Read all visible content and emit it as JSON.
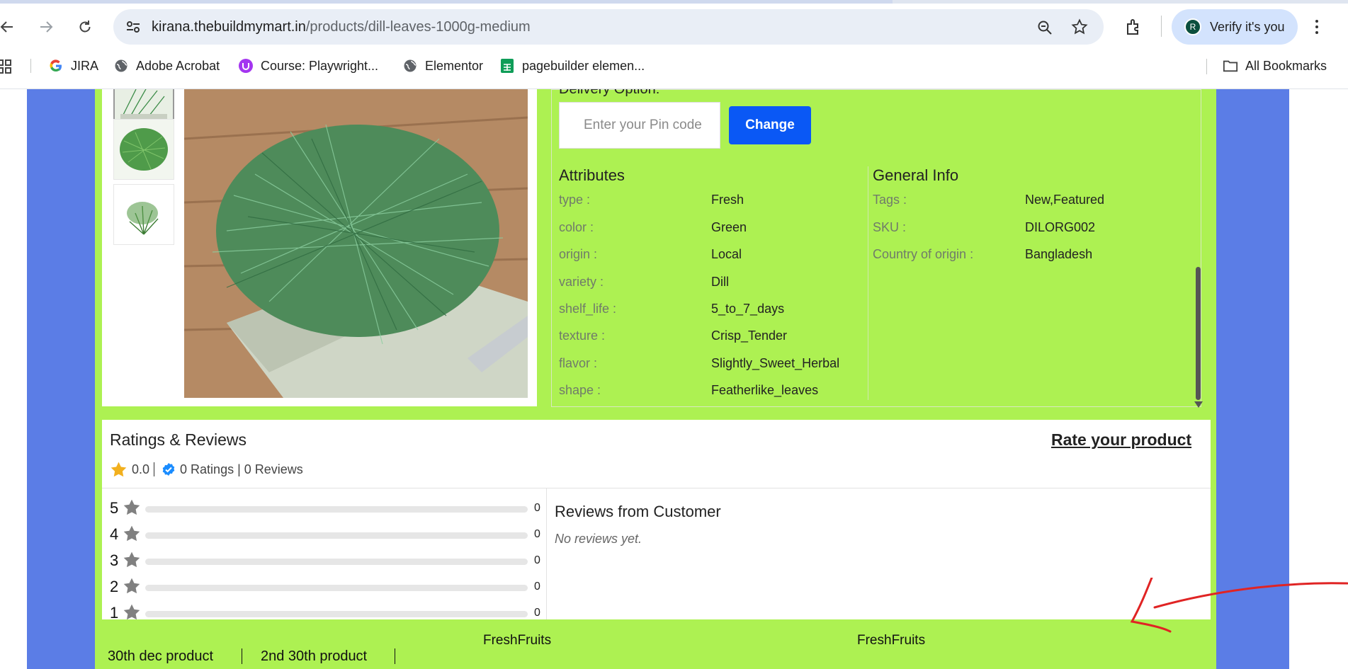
{
  "browser": {
    "url_host": "kirana.thebuildmymart.in",
    "url_path": "/products/dill-leaves-1000g-medium",
    "profile_initial": "R",
    "verify_label": "Verify it's you",
    "bookmarks": [
      {
        "label": "JIRA",
        "icon": "google-icon"
      },
      {
        "label": "Adobe Acrobat",
        "icon": "globe-icon"
      },
      {
        "label": "Course: Playwright...",
        "icon": "udemy-icon"
      },
      {
        "label": "Elementor",
        "icon": "globe-icon"
      },
      {
        "label": "pagebuilder elemen...",
        "icon": "sheets-icon"
      }
    ],
    "all_bookmarks_label": "All Bookmarks"
  },
  "delivery": {
    "label": "Delivery Option:",
    "pin_placeholder": "Enter your Pin code",
    "change_label": "Change"
  },
  "attributes": {
    "heading": "Attributes",
    "items": [
      {
        "label": "type :",
        "value": "Fresh"
      },
      {
        "label": "color :",
        "value": "Green"
      },
      {
        "label": "origin :",
        "value": "Local"
      },
      {
        "label": "variety :",
        "value": "Dill"
      },
      {
        "label": "shelf_life :",
        "value": "5_to_7_days"
      },
      {
        "label": "texture :",
        "value": "Crisp_Tender"
      },
      {
        "label": "flavor :",
        "value": "Slightly_Sweet_Herbal"
      },
      {
        "label": "shape :",
        "value": "Featherlike_leaves"
      }
    ]
  },
  "general_info": {
    "heading": "General Info",
    "items": [
      {
        "label": "Tags :",
        "value": "New,Featured"
      },
      {
        "label": "SKU :",
        "value": "DILORG002"
      },
      {
        "label": "Country of origin :",
        "value": "Bangladesh"
      }
    ]
  },
  "ratings": {
    "title": "Ratings & Reviews",
    "rate_link": "Rate your product",
    "average": "0.0",
    "summary_text": "0 Ratings | 0 Reviews",
    "breakdown": [
      {
        "stars": "5",
        "count": "0",
        "fraction": 0
      },
      {
        "stars": "4",
        "count": "0",
        "fraction": 0
      },
      {
        "stars": "3",
        "count": "0",
        "fraction": 0
      },
      {
        "stars": "2",
        "count": "0",
        "fraction": 0
      },
      {
        "stars": "1",
        "count": "0",
        "fraction": 0
      }
    ],
    "reviews_heading": "Reviews from Customer",
    "no_reviews": "No reviews yet."
  },
  "footer": {
    "col1_title": "FreshFruits",
    "col2_title": "FreshFruits",
    "links": [
      "30th dec product",
      "2nd 30th product"
    ]
  },
  "colors": {
    "page_green": "#adf152",
    "page_blue": "#5b7de6",
    "change_button": "#0a58f5",
    "annotation_arrow": "#e02424"
  }
}
